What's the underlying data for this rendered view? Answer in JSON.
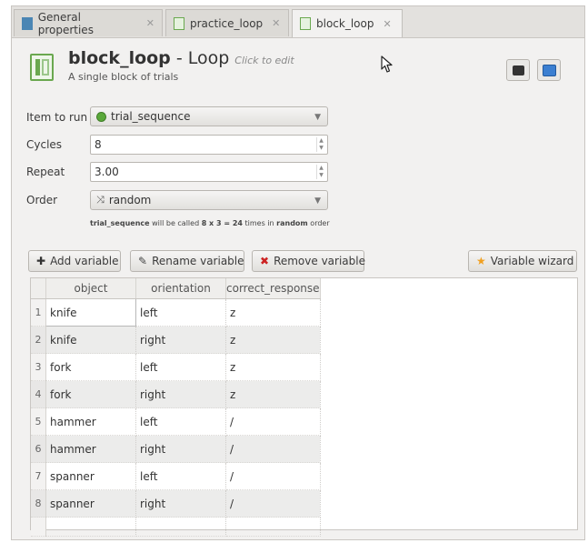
{
  "tabs": [
    {
      "label": "General properties",
      "icon": "general-properties-icon"
    },
    {
      "label": "practice_loop",
      "icon": "loop-icon"
    },
    {
      "label": "block_loop",
      "icon": "loop-icon",
      "active": true
    }
  ],
  "header": {
    "name": "block_loop",
    "type": " - Loop",
    "click_to_edit": "Click to edit",
    "description": "A single block of trials"
  },
  "form": {
    "item_to_run": {
      "label": "Item to run",
      "value": "trial_sequence"
    },
    "cycles": {
      "label": "Cycles",
      "value": "8"
    },
    "repeat": {
      "label": "Repeat",
      "value": "3.00"
    },
    "order": {
      "label": "Order",
      "value": "random"
    },
    "summary": {
      "item": "trial_sequence",
      "middle": " will be called ",
      "formula": "8 x 3 = 24",
      "times_in": " times in ",
      "order": "random",
      "suffix": " order"
    }
  },
  "toolbar": {
    "add": "Add variable",
    "rename": "Rename variable",
    "remove": "Remove variable",
    "wizard": "Variable wizard"
  },
  "table": {
    "columns": [
      "object",
      "orientation",
      "correct_response"
    ],
    "rows": [
      [
        "knife",
        "left",
        "z"
      ],
      [
        "knife",
        "right",
        "z"
      ],
      [
        "fork",
        "left",
        "z"
      ],
      [
        "fork",
        "right",
        "z"
      ],
      [
        "hammer",
        "left",
        "/"
      ],
      [
        "hammer",
        "right",
        "/"
      ],
      [
        "spanner",
        "left",
        "/"
      ],
      [
        "spanner",
        "right",
        "/"
      ]
    ]
  },
  "colors": {
    "loop_green": "#6aa84f",
    "remove_red": "#cc2222",
    "wizard_orange": "#f0a020",
    "tab_blue": "#4b86b4"
  }
}
